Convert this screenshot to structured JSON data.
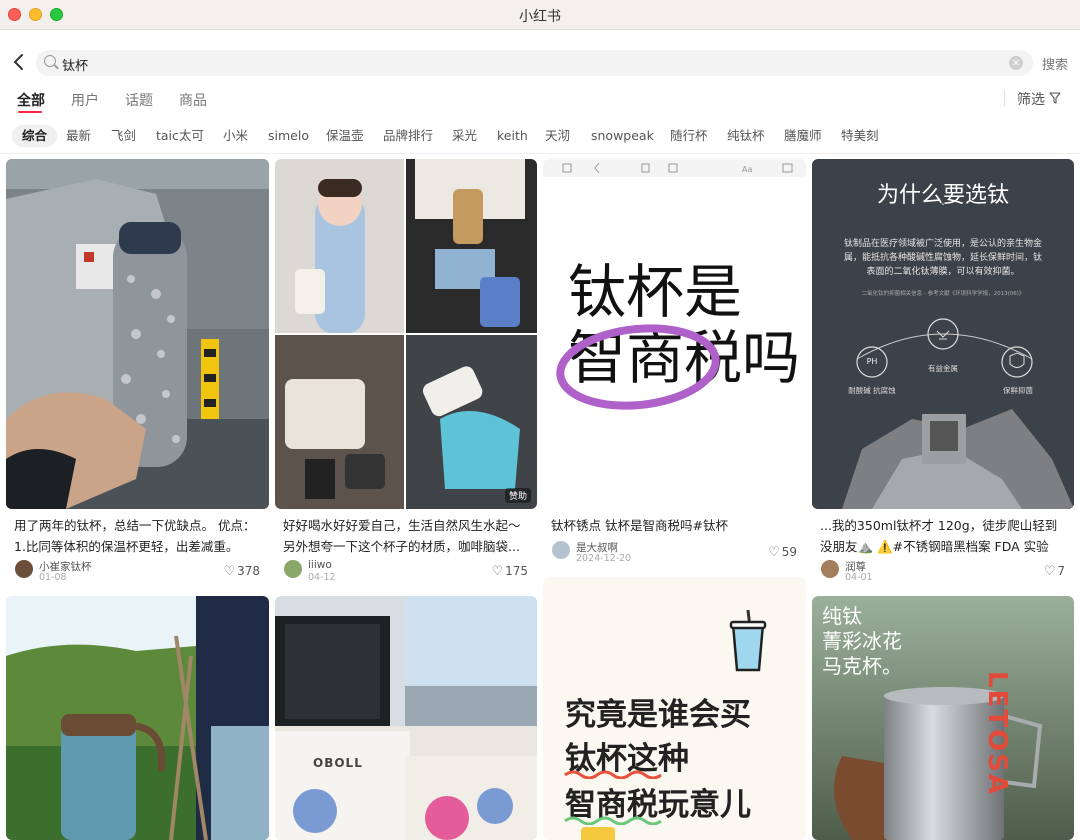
{
  "window": {
    "title": "小红书"
  },
  "search": {
    "query": "钛杯",
    "submit_label": "搜索",
    "clear_glyph": "×"
  },
  "tabs": [
    "全部",
    "用户",
    "话题",
    "商品"
  ],
  "filter_label": "筛选",
  "chips": [
    "综合",
    "最新",
    "飞剑",
    "taic太可",
    "小米",
    "simelo",
    "保温壶",
    "品牌排行",
    "采光",
    "keith",
    "天沏",
    "snowpeak",
    "随行杯",
    "纯钛杯",
    "膳魔师",
    "特美刻"
  ],
  "cards": [
    {
      "title": "用了两年的钛杯，总结一下优缺点。 优点：1.比同等体积的保温杯更轻，出差减重。 2...",
      "author": "小崔家钛杯",
      "date": "01-08",
      "likes": "378"
    },
    {
      "title": "好好喝水好好爱自己，生活自然风生水起～另外想夸一下这个杯子的材质，咖啡脑袋...",
      "author": "iiiwo",
      "date": "04-12",
      "likes": "175",
      "badge": "赞助"
    },
    {
      "title": "钛杯锈点 钛杯是智商税吗#钛杯",
      "author": "是大叔啊",
      "date": "2024-12-20",
      "likes": "59",
      "cover_text": {
        "line1": "钛杯是",
        "line2": "智商税吗"
      }
    },
    {
      "title": "...我的350ml钛杯才 120g，徒步爬山轻到没朋友⛰️ ⚠️#不锈钢暗黑档案 FDA 实验显...",
      "author": "润尊",
      "date": "04-01",
      "likes": "7",
      "cover_text": {
        "heading": "为什么要选钛",
        "body": "钛制品在医疗领域被广泛使用，是公认的亲生物金属，能抵抗各种酸碱性腐蚀物，延长保鲜时间，钛表面的二氧化钛薄膜，可以有效抑菌。",
        "source": "二氧化钛的抑菌相关信息 - 参考文献《环境科学学报，2013(06)》",
        "ph": "PH",
        "f1": "耐酸碱 抗腐蚀",
        "f2": "有益金属",
        "f3": "保鲜抑菌"
      }
    },
    {
      "title": "",
      "author": "",
      "date": "",
      "likes": ""
    },
    {
      "title": "",
      "author": "",
      "date": "",
      "likes": "",
      "cover_text": {
        "brand": "OBOLL"
      }
    },
    {
      "title": "",
      "author": "",
      "date": "",
      "likes": "",
      "cover_text": {
        "line1": "究竟是谁会买",
        "line2": "钛杯这种",
        "line3": "智商税玩意儿"
      }
    },
    {
      "title": "",
      "author": "",
      "date": "",
      "likes": "",
      "cover_text": {
        "line1": "纯钛",
        "line2": "菁彩冰花",
        "line3": "马克杯。",
        "brand": "LETOSA"
      }
    }
  ]
}
